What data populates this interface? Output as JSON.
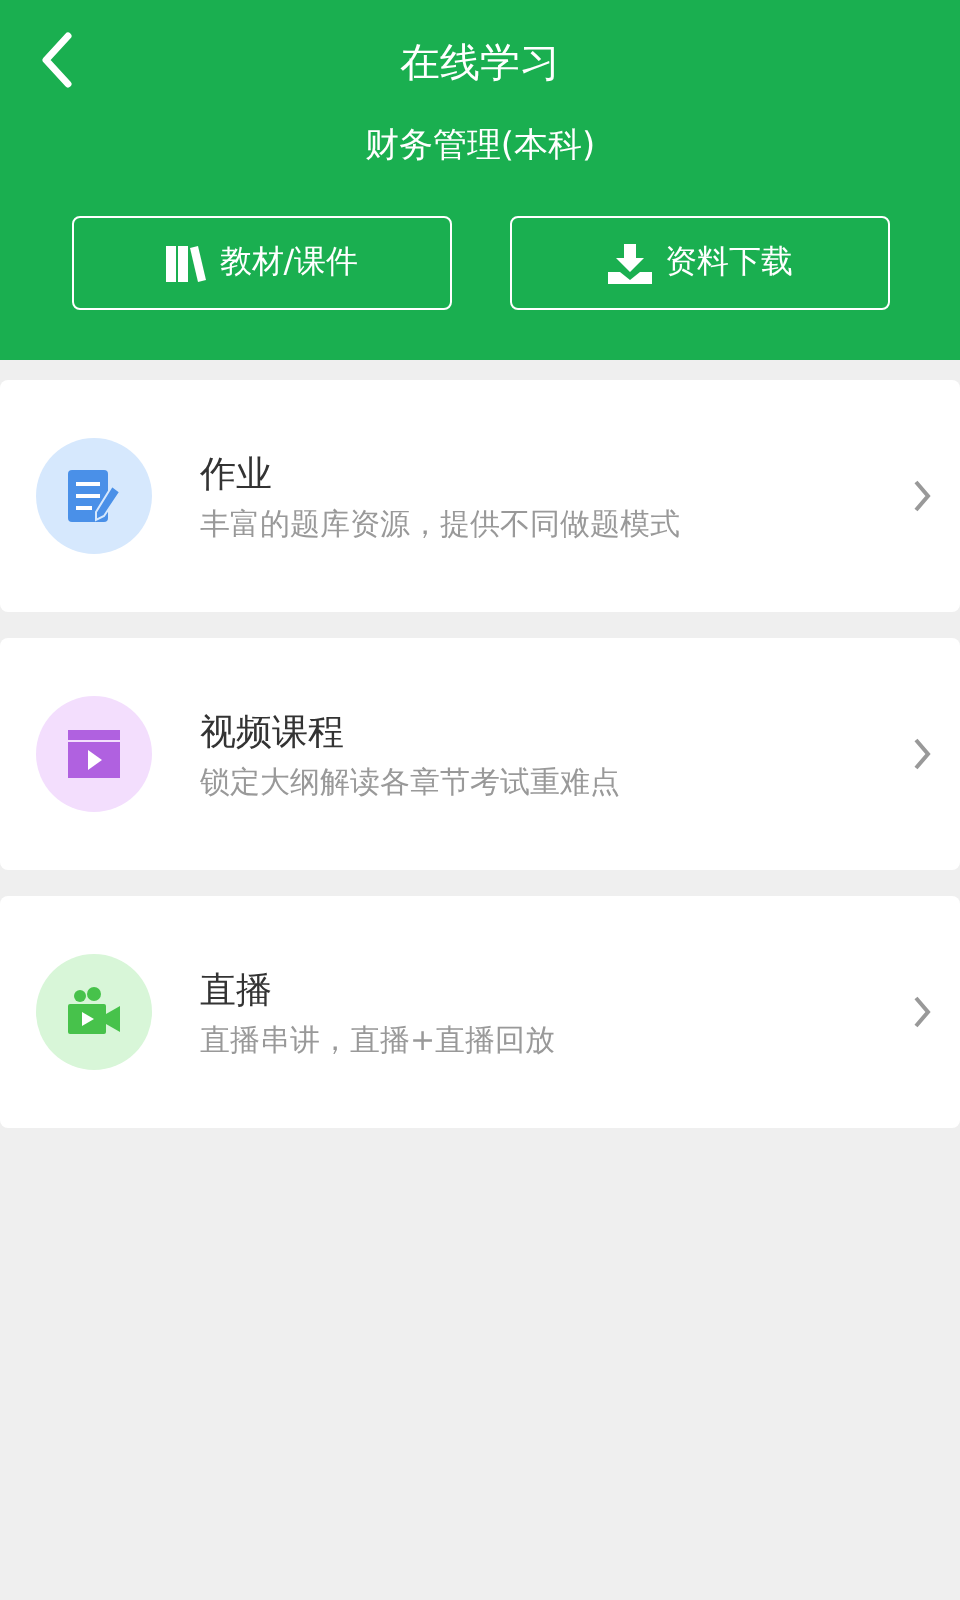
{
  "header": {
    "title": "在线学习",
    "subtitle": "财务管理(本科)",
    "buttons": [
      {
        "kind": "books",
        "label": "教材/课件"
      },
      {
        "kind": "download",
        "label": "资料下载"
      }
    ]
  },
  "items": [
    {
      "kind": "homework",
      "title": "作业",
      "description": "丰富的题库资源，提供不同做题模式"
    },
    {
      "kind": "video",
      "title": "视频课程",
      "description": "锁定大纲解读各章节考试重难点"
    },
    {
      "kind": "live",
      "title": "直播",
      "description": "直播串讲，直播+直播回放"
    }
  ]
}
